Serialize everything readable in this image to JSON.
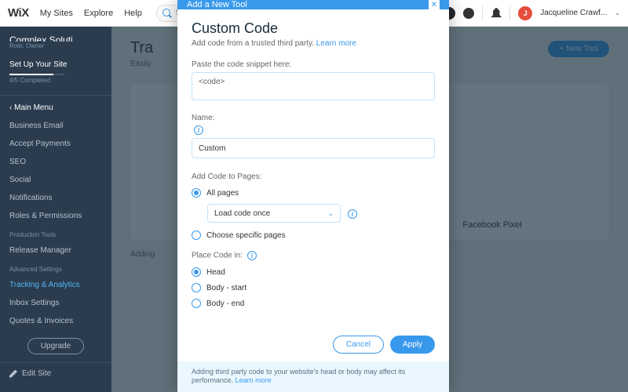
{
  "top": {
    "logo": "WiX",
    "nav": [
      "My Sites",
      "Explore",
      "Help"
    ],
    "search_placeholder": "Search for tools, apps, help & more...",
    "user_initial": "J",
    "user_name": "Jacqueline Crawf..."
  },
  "sidebar": {
    "site_name": "Complex Soluti...",
    "role": "Role: Owner",
    "setup": "Set Up Your Site",
    "progress": "4/5 Completed",
    "back": "Main Menu",
    "items": [
      "Business Email",
      "Accept Payments",
      "SEO",
      "Social",
      "Notifications",
      "Roles & Permissions"
    ],
    "section_prod": "Production Tools",
    "prod_items": [
      "Release Manager"
    ],
    "section_adv": "Advanced Settings",
    "adv_items": [
      "Tracking & Analytics",
      "Inbox Settings",
      "Quotes & Invoices"
    ],
    "upgrade": "Upgrade",
    "edit": "Edit Site"
  },
  "page": {
    "title_visible": "Tra",
    "subtitle_visible": "Easily",
    "new_tool": "+   New Tool",
    "analytics_card": "",
    "fb_card": "Facebook Pixel",
    "bottom": "Adding"
  },
  "modal": {
    "header": "Add a New Tool",
    "title": "Custom Code",
    "desc": "Add code from a trusted third party.",
    "learn": "Learn more",
    "paste_label": "Paste the code snippet here:",
    "code_value": "<code>",
    "name_label": "Name:",
    "name_value": "Custom",
    "pages_label": "Add Code to Pages:",
    "all_pages": "All pages",
    "load_once": "Load code once",
    "choose_pages": "Choose specific pages",
    "place_label": "Place Code in:",
    "head": "Head",
    "body_start": "Body - start",
    "body_end": "Body - end",
    "cancel": "Cancel",
    "apply": "Apply",
    "tip": "Adding third party code to your website's head or body may affect its performance.",
    "tip_learn": "Learn more"
  }
}
